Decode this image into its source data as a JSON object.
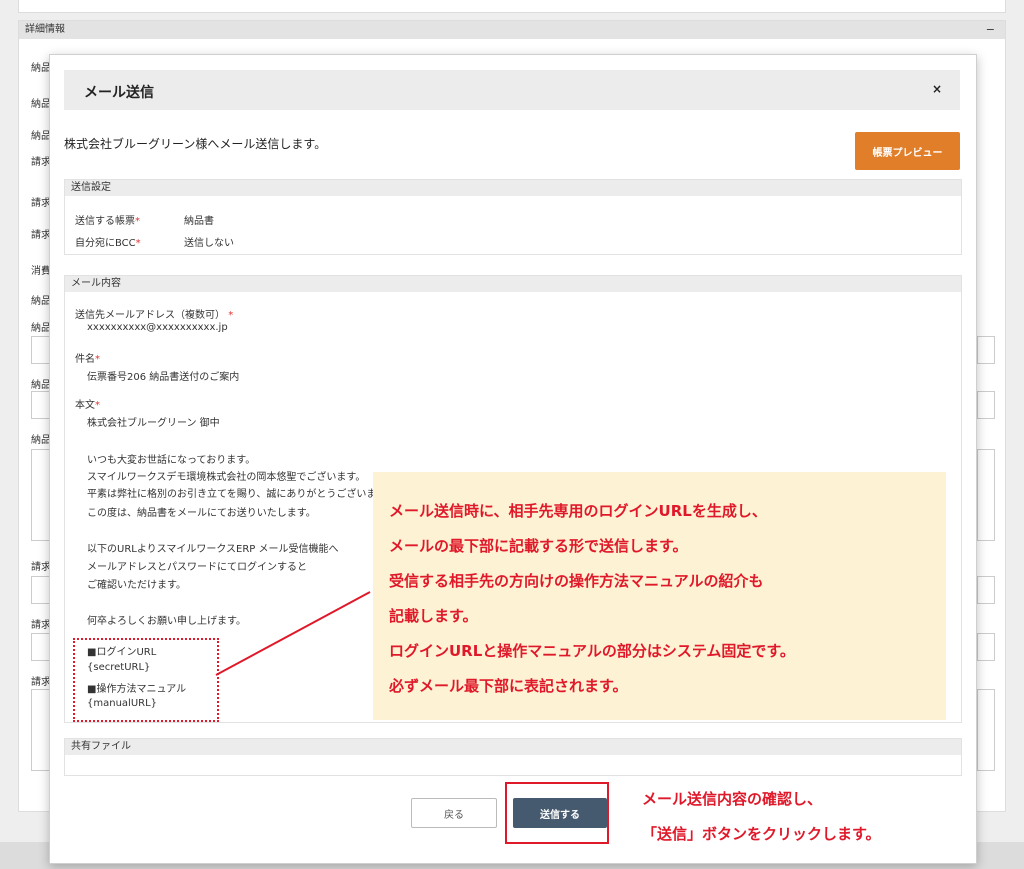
{
  "background": {
    "panel_title": "詳細情報",
    "collapse": "−",
    "labels": [
      "納品",
      "納品",
      "納品",
      "請求",
      "請求",
      "請求",
      "消費",
      "納品",
      "納品",
      "納品",
      "納品",
      "請求",
      "請求",
      "請求"
    ]
  },
  "dialog": {
    "title": "メール送信",
    "close": "×",
    "intro": "株式会社ブルーグリーン様へメール送信します。",
    "preview_button": "帳票プレビュー"
  },
  "send_settings": {
    "header": "送信設定",
    "form_label": "送信する帳票",
    "form_value": "納品書",
    "bcc_label": "自分宛にBCC",
    "bcc_value": "送信しない",
    "required_mark": "*"
  },
  "mail_content": {
    "header": "メール内容",
    "to_label": "送信先メールアドレス（複数可）",
    "to_value": "xxxxxxxxxx@xxxxxxxxxx.jp",
    "subject_label": "件名",
    "subject_value": "伝票番号206 納品書送付のご案内",
    "body_label": "本文",
    "body_lines": [
      "株式会社ブルーグリーン 御中",
      "いつも大変お世話になっております。",
      "スマイルワークスデモ環境株式会社の岡本悠聖でございます。",
      "平素は弊社に格別のお引き立てを賜り、誠にありがとうございます。",
      "この度は、納品書をメールにてお送りいたします。",
      "以下のURLよりスマイルワークスERP メール受信機能へ",
      "メールアドレスとパスワードにてログインすると",
      "ご確認いただけます。",
      "何卒よろしくお願い申し上げます。",
      "■ログインURL",
      "{secretURL}",
      "■操作方法マニュアル",
      "{manualURL}"
    ]
  },
  "shared_files": {
    "header": "共有ファイル"
  },
  "callout": {
    "lines": [
      "メール送信時に、相手先専用のログインURLを生成し、",
      "メールの最下部に記載する形で送信します。",
      "受信する相手先の方向けの操作方法マニュアルの紹介も",
      "記載します。",
      "ログインURLと操作マニュアルの部分はシステム固定です。",
      "必ずメール最下部に表記されます。"
    ]
  },
  "footer": {
    "back_button": "戻る",
    "send_button": "送信する",
    "note_lines": [
      "メール送信内容の確認し、",
      "「送信」ボタンをクリックします。"
    ]
  },
  "colors": {
    "accent_orange": "#e07e2a",
    "send_button": "#455a6e",
    "annotation_red": "#e0192a",
    "callout_bg": "#fdf3d4"
  }
}
